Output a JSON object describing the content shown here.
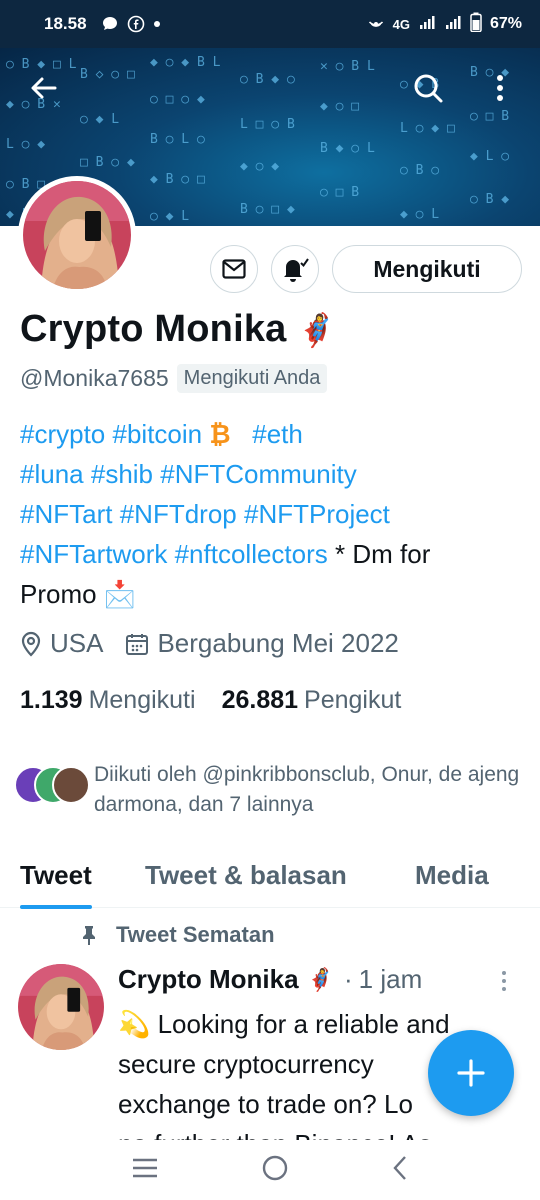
{
  "status_bar": {
    "time": "18.58",
    "network": "4G",
    "battery": "67%",
    "icons": [
      "chat-bubble-icon",
      "facebook-icon",
      "dot-icon",
      "hotspot-icon",
      "signal-icon",
      "signal-icon",
      "battery-icon"
    ]
  },
  "header": {
    "back_icon": "arrow-left-icon",
    "search_icon": "search-icon",
    "more_icon": "more-vertical-icon"
  },
  "profile": {
    "actions": {
      "message_icon": "envelope-icon",
      "notify_icon": "bell-check-icon",
      "follow_label": "Mengikuti"
    },
    "name": "Crypto Monika",
    "name_emoji": "🦸‍♀️",
    "handle": "@Monika7685",
    "follows_you": "Mengikuti Anda",
    "bio": {
      "line1_tags": [
        "#crypto",
        "#bitcoin"
      ],
      "btc_symbol": "₿",
      "line1_tag_after": "#eth",
      "line2_tags": [
        "#luna",
        "#shib",
        "#NFTCommunity"
      ],
      "line3_tags": [
        "#NFTart",
        "#NFTdrop",
        "#NFTProject"
      ],
      "line4_tags": [
        "#NFTartwork",
        "#nftcollectors"
      ],
      "line4_text": " * Dm for",
      "line5_text": "Promo",
      "line5_emoji": "📩"
    },
    "location": "USA",
    "joined": "Bergabung Mei 2022",
    "following_count": "1.139",
    "following_label": "Mengikuti",
    "followers_count": "26.881",
    "followers_label": "Pengikut",
    "followed_by": "Diikuti oleh @pinkribbonsclub, Onur, de ajeng darmona, dan 7 lainnya"
  },
  "tabs": [
    "Tweet",
    "Tweet & balasan",
    "Media"
  ],
  "pinned_label": "Tweet Sematan",
  "tweet": {
    "author": "Crypto Monika",
    "author_emoji": "🦸‍♀️",
    "separator": "·",
    "time": "1 jam",
    "text_emoji": "💫",
    "text_line1": " Looking for a reliable and",
    "text_line2": "secure cryptocurrency",
    "text_line3": "exchange to trade on? Lo",
    "text_line4": "no further than Binance! As"
  },
  "colors": {
    "accent": "#1d9bf0",
    "status_bar": "#0d2740",
    "banner": "#0b4470",
    "muted_text": "#536471",
    "bitcoin": "#f7931a"
  },
  "fab_icon": "plus-icon",
  "nav": [
    "menu-icon",
    "home-circle-icon",
    "back-chevron-icon"
  ]
}
